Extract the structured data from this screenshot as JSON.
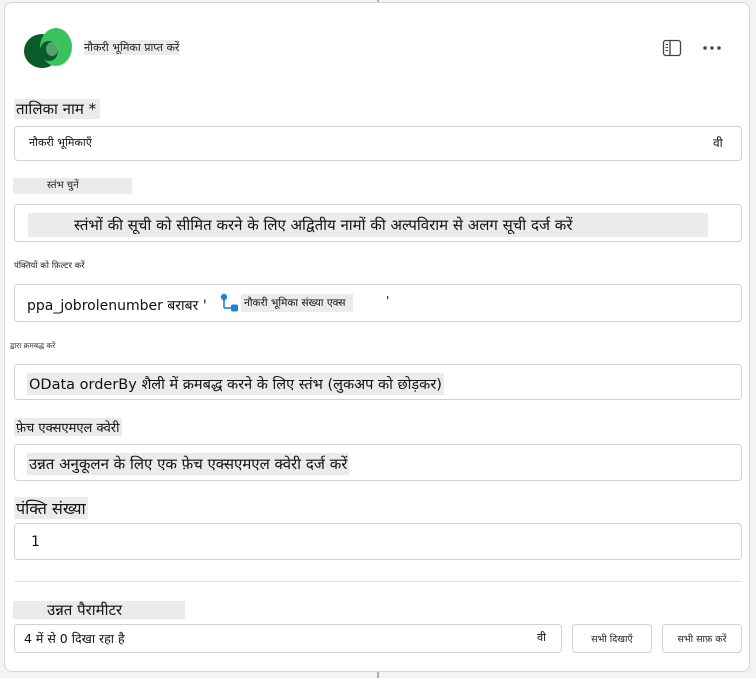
{
  "header": {
    "title": "नौकरी भूमिका प्राप्त करें",
    "panel_icon": "side-panel-icon",
    "more_icon": "more-options-icon",
    "logo_icon": "dataverse-logo-icon"
  },
  "table_name": {
    "label": "तालिका नाम *",
    "value": "नौकरी भूमिकाएँ",
    "dropdown_glyph": "वी"
  },
  "select_columns": {
    "label": "स्तंभ चुनें",
    "placeholder": "स्तंभों की सूची को सीमित करने के लिए अद्वितीय नामों की अल्पविराम से अलग सूची दर्ज करें"
  },
  "filter_rows": {
    "label": "पंक्तियों को फ़िल्टर करें",
    "prefix": "ppa_jobrolenumber बराबर '",
    "token_label": "नौकरी भूमिका संख्या एक्स",
    "suffix": "'",
    "token_icon": "flow-token-icon"
  },
  "sort_by": {
    "label": "द्वारा क्रमबद्ध करें",
    "placeholder": "OData orderBy शैली में क्रमबद्ध करने के लिए स्तंभ (लुकअप को छोड़कर)"
  },
  "fetch_xml": {
    "label": "फ़ेच एक्सएमएल क्वेरी",
    "placeholder": "उन्नत अनुकूलन के लिए एक फ़ेच एक्सएमएल क्वेरी दर्ज करें"
  },
  "row_count": {
    "label": "पंक्ति संख्या",
    "value": "1"
  },
  "advanced": {
    "label": "उन्नत पैरामीटर",
    "showing": "4 में से 0 दिखा रहा है",
    "dropdown_glyph": "वी",
    "show_all": "सभी दिखाएँ",
    "clear_all": "सभी साफ़ करें"
  },
  "colors": {
    "accent": "#0f6cbd",
    "logo_dark": "#0b5a2a",
    "logo_light": "#3ac25c",
    "highlight": "#ebebeb",
    "border": "#d1d1d1"
  }
}
